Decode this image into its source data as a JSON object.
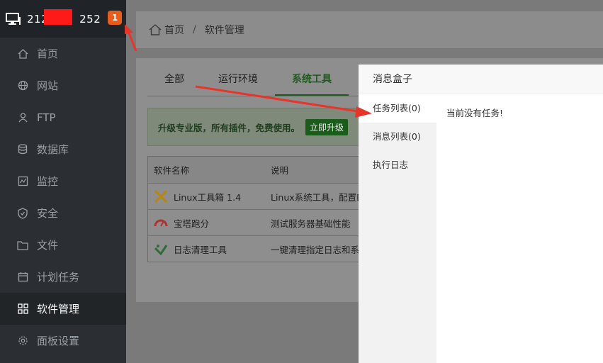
{
  "sidebar": {
    "ip_prefix": "212",
    "ip_suffix": "252",
    "badge": "1",
    "items": [
      {
        "label": "首页",
        "icon": "home-icon"
      },
      {
        "label": "网站",
        "icon": "globe-icon"
      },
      {
        "label": "FTP",
        "icon": "ftp-icon"
      },
      {
        "label": "数据库",
        "icon": "database-icon"
      },
      {
        "label": "监控",
        "icon": "monitor-icon"
      },
      {
        "label": "安全",
        "icon": "shield-icon"
      },
      {
        "label": "文件",
        "icon": "folder-icon"
      },
      {
        "label": "计划任务",
        "icon": "calendar-icon"
      },
      {
        "label": "软件管理",
        "icon": "grid-icon"
      },
      {
        "label": "面板设置",
        "icon": "gear-icon"
      }
    ]
  },
  "breadcrumb": {
    "home": "首页",
    "separator": "/",
    "current": "软件管理"
  },
  "tabs": [
    "全部",
    "运行环境",
    "系统工具"
  ],
  "promo": {
    "text": "升级专业版，所有插件，免费使用。",
    "button": "立即升级"
  },
  "table": {
    "headers": [
      "软件名称",
      "说明"
    ],
    "rows": [
      {
        "name": "Linux工具箱 1.4",
        "desc": "Linux系统工具，配置DNS",
        "icon": "tools-icon"
      },
      {
        "name": "宝塔跑分",
        "desc": "测试服务器基础性能",
        "icon": "gauge-icon"
      },
      {
        "name": "日志清理工具",
        "desc": "一键清理指定日志和系统",
        "icon": "broom-icon"
      }
    ]
  },
  "msgbox": {
    "title": "消息盒子",
    "nav": [
      "任务列表(0)",
      "消息列表(0)",
      "执行日志"
    ],
    "content": "当前没有任务!"
  },
  "colors": {
    "accent": "#20a53a",
    "badge": "#e85d1c",
    "arrow": "#e8352a",
    "sidebar": "#2b2e33"
  }
}
